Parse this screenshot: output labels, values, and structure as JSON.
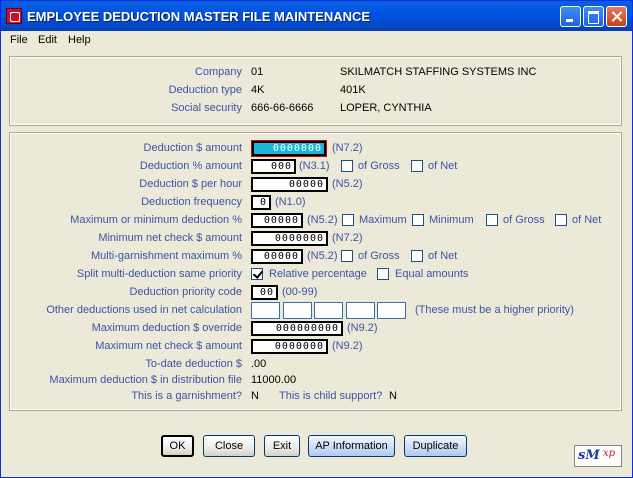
{
  "window": {
    "title": "EMPLOYEE DEDUCTION MASTER FILE MAINTENANCE"
  },
  "menu": {
    "file": "File",
    "edit": "Edit",
    "help": "Help"
  },
  "header": {
    "company_label": "Company",
    "company_code": "01",
    "company_name": "SKILMATCH STAFFING SYSTEMS INC",
    "dedtype_label": "Deduction type",
    "dedtype_code": "4K",
    "dedtype_name": "401K",
    "ssn_label": "Social security",
    "ssn": "666-66-6666",
    "employee_name": "LOPER, CYNTHIA"
  },
  "form": {
    "amount_label": "Deduction $ amount",
    "amount_value": "0000000",
    "amount_fmt": "(N7.2)",
    "pct_label": "Deduction % amount",
    "pct_value": "000",
    "pct_fmt": "(N3.1)",
    "pct_gross": "of Gross",
    "pct_net": "of Net",
    "hour_label": "Deduction $ per hour",
    "hour_value": "00000",
    "hour_fmt": "(N5.2)",
    "freq_label": "Deduction frequency",
    "freq_value": "0",
    "freq_fmt": "(N1.0)",
    "maxmin_label": "Maximum or minimum deduction %",
    "maxmin_value": "00000",
    "maxmin_fmt": "(N5.2)",
    "maxmin_max": "Maximum",
    "maxmin_min": "Minimum",
    "maxmin_gross": "of Gross",
    "maxmin_net": "of Net",
    "minnet_label": "Minimum net check $ amount",
    "minnet_value": "0000000",
    "minnet_fmt": "(N7.2)",
    "multi_label": "Multi-garnishment maximum %",
    "multi_value": "00000",
    "multi_fmt": "(N5.2)",
    "multi_gross": "of Gross",
    "multi_net": "of Net",
    "split_label": "Split multi-deduction same priority",
    "split_rel": "Relative percentage",
    "split_eq": "Equal amounts",
    "prio_label": "Deduction priority code",
    "prio_value": "00",
    "prio_fmt": "(00-99)",
    "other_label": "Other deductions used in net calculation",
    "other_hint": "(These must be a higher priority)",
    "maxover_label": "Maximum deduction $ override",
    "maxover_value": "000000000",
    "maxover_fmt": "(N9.2)",
    "maxnet_label": "Maximum net check $ amount",
    "maxnet_value": "0000000",
    "maxnet_fmt": "(N9.2)",
    "todate_label": "To-date deduction $",
    "todate_value": ".00",
    "maxdist_label": "Maximum deduction $ in distribution file",
    "maxdist_value": "11000.00",
    "garn_label": "This is a garnishment?",
    "garn_value": "N",
    "child_label": "This is child support?",
    "child_value": "N"
  },
  "checks": {
    "relative_percentage": true
  },
  "buttons": {
    "ok": "OK",
    "close": "Close",
    "exit": "Exit",
    "ap": "AP Information",
    "dup": "Duplicate"
  },
  "logo": {
    "text": "sM",
    "sup": "xp"
  }
}
